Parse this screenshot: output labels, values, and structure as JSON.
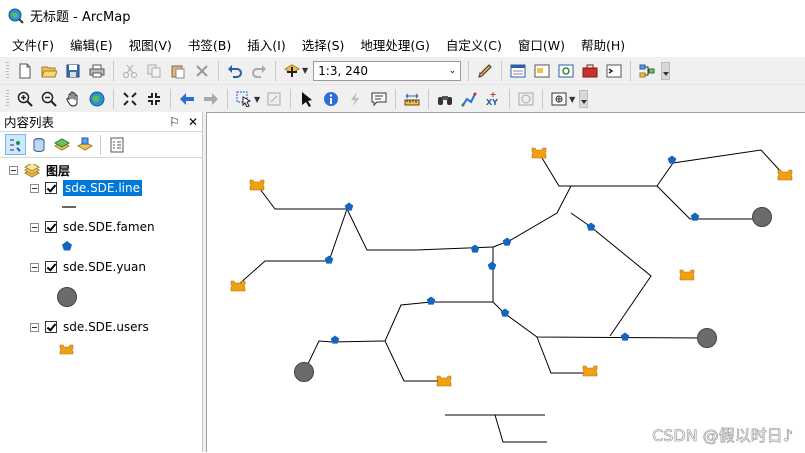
{
  "window": {
    "title": "无标题 - ArcMap"
  },
  "menu": [
    "文件(F)",
    "编辑(E)",
    "视图(V)",
    "书签(B)",
    "插入(I)",
    "选择(S)",
    "地理处理(G)",
    "自定义(C)",
    "窗口(W)",
    "帮助(H)"
  ],
  "toolbar": {
    "scale": "1:3, 240"
  },
  "toc": {
    "title": "内容列表",
    "pin_glyph": "⚐",
    "close_glyph": "✕",
    "group_label": "图层",
    "layers": [
      {
        "name": "sde.SDE.line"
      },
      {
        "name": "sde.SDE.famen"
      },
      {
        "name": "sde.SDE.yuan"
      },
      {
        "name": "sde.SDE.users"
      }
    ]
  },
  "colors": {
    "valve": "#1565c0",
    "user": "#f0a010",
    "circle": "#6b6b6b",
    "selection": "#0078d7"
  },
  "watermark": "CSDN @假以时日♪"
}
